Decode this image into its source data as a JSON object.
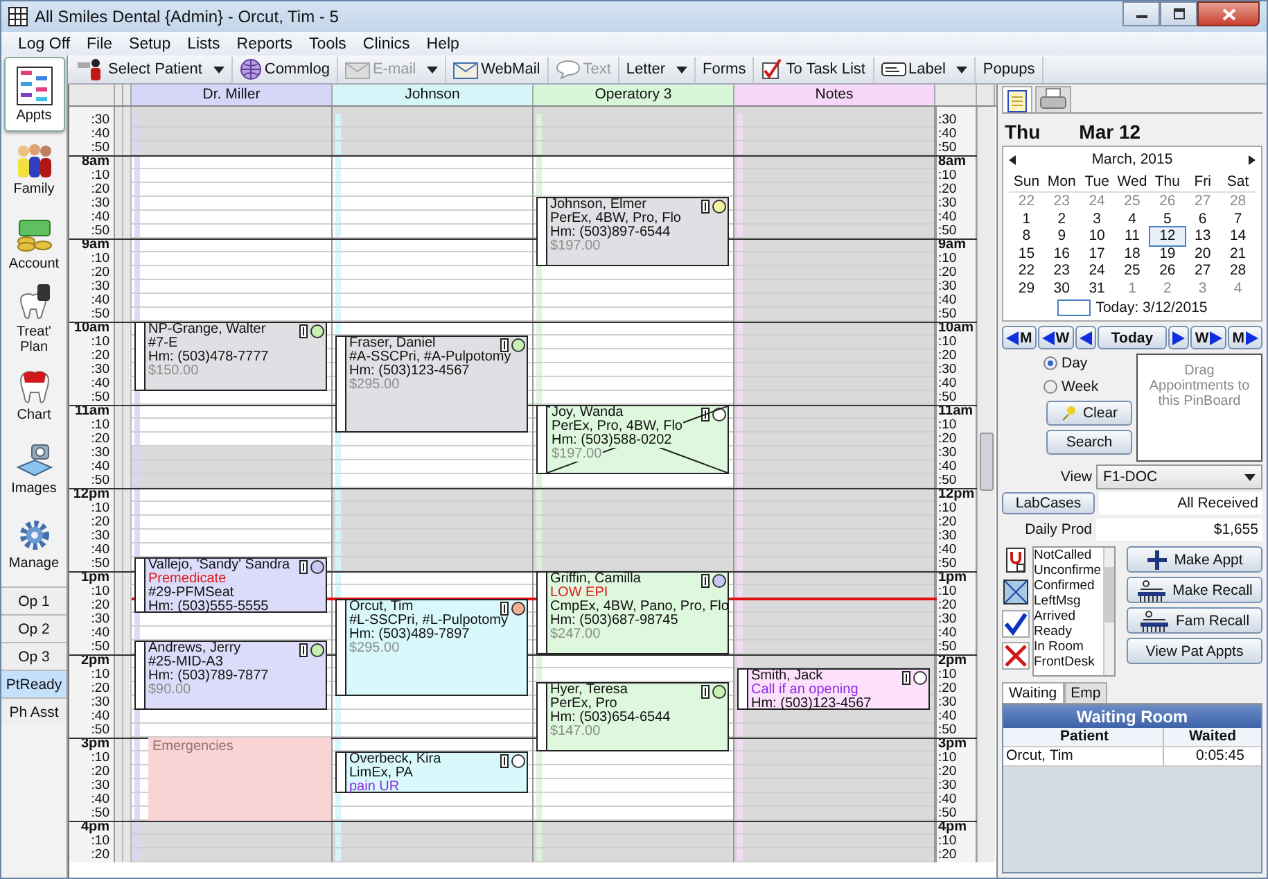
{
  "window": {
    "title": "All Smiles Dental {Admin} - Orcut, Tim - 5"
  },
  "menu": [
    "Log Off",
    "File",
    "Setup",
    "Lists",
    "Reports",
    "Tools",
    "Clinics",
    "Help"
  ],
  "toolbar": [
    {
      "label": "Select Patient",
      "disabled": false,
      "dropdown": true
    },
    {
      "label": "Commlog",
      "disabled": false,
      "dropdown": false
    },
    {
      "label": "E-mail",
      "disabled": true,
      "dropdown": true
    },
    {
      "label": "WebMail",
      "disabled": false,
      "dropdown": false
    },
    {
      "label": "Text",
      "disabled": true,
      "dropdown": false
    },
    {
      "label": "Letter",
      "disabled": false,
      "dropdown": true
    },
    {
      "label": "Forms",
      "disabled": false,
      "dropdown": false
    },
    {
      "label": "To Task List",
      "disabled": false,
      "dropdown": false
    },
    {
      "label": "Label",
      "disabled": false,
      "dropdown": true
    },
    {
      "label": "Popups",
      "disabled": false,
      "dropdown": false
    }
  ],
  "modules": [
    {
      "label": "Appts",
      "selected": true
    },
    {
      "label": "Family",
      "selected": false
    },
    {
      "label": "Account",
      "selected": false
    },
    {
      "label": "Treat' Plan",
      "selected": false
    },
    {
      "label": "Chart",
      "selected": false
    },
    {
      "label": "Images",
      "selected": false
    },
    {
      "label": "Manage",
      "selected": false
    }
  ],
  "views": [
    {
      "label": "Op 1",
      "selected": false
    },
    {
      "label": "Op 2",
      "selected": false
    },
    {
      "label": "Op 3",
      "selected": false
    },
    {
      "label": "PtReady",
      "selected": true
    },
    {
      "label": "Ph Asst",
      "selected": false
    }
  ],
  "schedule": {
    "columns": [
      {
        "name": "Dr. Miller",
        "color": "#d6d6f8",
        "blocks": [
          {
            "label": "Emergencies",
            "color": "#fad4d4"
          }
        ],
        "appointments": [
          {
            "color": "#e0e0e4",
            "broken": false,
            "dot": {
              "color": "#c8f0b0"
            },
            "lines": [
              {
                "kind": "text",
                "text": "NP-Grange, Walter"
              },
              {
                "kind": "text",
                "text": "#7-E"
              },
              {
                "kind": "text",
                "text": "Hm: (503)478-7777"
              },
              {
                "kind": "fee",
                "text": "$150.00"
              }
            ]
          },
          {
            "color": "#dcdcfa",
            "broken": false,
            "dot": {
              "color": "#c8c8f4"
            },
            "lines": [
              {
                "kind": "text",
                "text": "Vallejo, 'Sandy' Sandra"
              },
              {
                "kind": "alert",
                "text": "Premedicate"
              },
              {
                "kind": "text",
                "text": "#29-PFMSeat"
              },
              {
                "kind": "text",
                "text": "Hm: (503)555-5555"
              }
            ]
          },
          {
            "color": "#dcdcfa",
            "broken": false,
            "dot": {
              "color": "#c8f0b0"
            },
            "lines": [
              {
                "kind": "text",
                "text": "Andrews, Jerry"
              },
              {
                "kind": "text",
                "text": "#25-MID-A3"
              },
              {
                "kind": "text",
                "text": "Hm: (503)789-7877"
              },
              {
                "kind": "fee",
                "text": "$90.00"
              }
            ]
          }
        ]
      },
      {
        "name": "Johnson",
        "color": "#d4f6f8",
        "appointments": [
          {
            "color": "#e0e0e4",
            "broken": false,
            "dot": {
              "color": "#c8f0b0"
            },
            "lines": [
              {
                "kind": "text",
                "text": "Fraser, Daniel"
              },
              {
                "kind": "text",
                "text": "#A-SSCPri, #A-Pulpotomy"
              },
              {
                "kind": "text",
                "text": "Hm: (503)123-4567"
              },
              {
                "kind": "fee",
                "text": "$295.00"
              }
            ]
          },
          {
            "color": "#d8f8fc",
            "broken": false,
            "dot": {
              "color": "#f4b090"
            },
            "lines": [
              {
                "kind": "text",
                "text": "Orcut, Tim"
              },
              {
                "kind": "text",
                "text": "#L-SSCPri, #L-Pulpotomy"
              },
              {
                "kind": "text",
                "text": "Hm: (503)489-7897"
              },
              {
                "kind": "fee",
                "text": "$295.00"
              }
            ]
          },
          {
            "color": "#d8f8fc",
            "broken": false,
            "dot": {
              "color": "#ffffff"
            },
            "lines": [
              {
                "kind": "text",
                "text": "Overbeck, Kira"
              },
              {
                "kind": "text",
                "text": "LimEx, PA"
              },
              {
                "kind": "note",
                "text": "pain UR"
              }
            ]
          }
        ]
      },
      {
        "name": "Operatory 3",
        "color": "#d8f6d8",
        "appointments": [
          {
            "color": "#e0e0e4",
            "broken": false,
            "dot": {
              "color": "#f4f0a0"
            },
            "lines": [
              {
                "kind": "text",
                "text": "Johnson, Elmer"
              },
              {
                "kind": "text",
                "text": "PerEx, 4BW, Pro, Flo"
              },
              {
                "kind": "text",
                "text": "Hm: (503)897-6544"
              },
              {
                "kind": "fee",
                "text": "$197.00"
              }
            ]
          },
          {
            "color": "#ddf8dd",
            "broken": true,
            "dot": {
              "color": "#ffffff"
            },
            "lines": [
              {
                "kind": "text",
                "text": "Joy, Wanda"
              },
              {
                "kind": "text",
                "text": "PerEx, Pro, 4BW, Flo"
              },
              {
                "kind": "text",
                "text": "Hm: (503)588-0202"
              },
              {
                "kind": "fee",
                "text": "$197.00"
              }
            ]
          },
          {
            "color": "#ddf8dd",
            "broken": false,
            "dot": {
              "color": "#c8c8f4"
            },
            "lines": [
              {
                "kind": "text",
                "text": "Griffin, Camilla"
              },
              {
                "kind": "alert",
                "text": "LOW EPI"
              },
              {
                "kind": "text",
                "text": "CmpEx, 4BW, Pano, Pro, Flo"
              },
              {
                "kind": "text",
                "text": "Hm: (503)687-98745"
              },
              {
                "kind": "fee",
                "text": "$247.00"
              }
            ]
          },
          {
            "color": "#ddf8dd",
            "broken": false,
            "dot": {
              "color": "#c8f0b0"
            },
            "lines": [
              {
                "kind": "text",
                "text": "Hyer, Teresa"
              },
              {
                "kind": "text",
                "text": "PerEx, Pro"
              },
              {
                "kind": "text",
                "text": "Hm: (503)654-6544"
              },
              {
                "kind": "fee",
                "text": "$147.00"
              }
            ]
          }
        ]
      },
      {
        "name": "Notes",
        "color": "#f8d8f8",
        "appointments": [
          {
            "color": "#fce0fc",
            "broken": false,
            "dot": {
              "color": "#ffffff"
            },
            "lines": [
              {
                "kind": "text",
                "text": "Smith, Jack"
              },
              {
                "kind": "note",
                "text": "Call if an opening"
              },
              {
                "kind": "text",
                "text": "Hm: (503)123-4567"
              }
            ]
          }
        ]
      }
    ],
    "time_labels_left": [
      {
        "text": ":30",
        "kind": "minute"
      },
      {
        "text": ":40",
        "kind": "minute"
      },
      {
        "text": ":50",
        "kind": "minute"
      },
      {
        "text": "8am",
        "kind": "hour"
      },
      {
        "text": ":10",
        "kind": "minute"
      },
      {
        "text": ":20",
        "kind": "minute"
      },
      {
        "text": ":30",
        "kind": "minute"
      },
      {
        "text": ":40",
        "kind": "minute"
      },
      {
        "text": ":50",
        "kind": "minute"
      },
      {
        "text": "9am",
        "kind": "hour"
      },
      {
        "text": ":10",
        "kind": "minute"
      },
      {
        "text": ":20",
        "kind": "minute"
      },
      {
        "text": ":30",
        "kind": "minute"
      },
      {
        "text": ":40",
        "kind": "minute"
      },
      {
        "text": ":50",
        "kind": "minute"
      },
      {
        "text": "10am",
        "kind": "hour"
      },
      {
        "text": ":10",
        "kind": "minute"
      },
      {
        "text": ":20",
        "kind": "minute"
      },
      {
        "text": ":30",
        "kind": "minute"
      },
      {
        "text": ":40",
        "kind": "minute"
      },
      {
        "text": ":50",
        "kind": "minute"
      },
      {
        "text": "11am",
        "kind": "hour"
      },
      {
        "text": ":10",
        "kind": "minute"
      },
      {
        "text": ":20",
        "kind": "minute"
      },
      {
        "text": ":30",
        "kind": "minute"
      },
      {
        "text": ":40",
        "kind": "minute"
      },
      {
        "text": ":50",
        "kind": "minute"
      },
      {
        "text": "12pm",
        "kind": "hour"
      },
      {
        "text": ":10",
        "kind": "minute"
      },
      {
        "text": ":20",
        "kind": "minute"
      },
      {
        "text": ":30",
        "kind": "minute"
      },
      {
        "text": ":40",
        "kind": "minute"
      },
      {
        "text": ":50",
        "kind": "minute"
      },
      {
        "text": "1pm",
        "kind": "hour"
      },
      {
        "text": ":10",
        "kind": "minute"
      },
      {
        "text": ":20",
        "kind": "minute"
      },
      {
        "text": ":30",
        "kind": "minute"
      },
      {
        "text": ":40",
        "kind": "minute"
      },
      {
        "text": ":50",
        "kind": "minute"
      },
      {
        "text": "2pm",
        "kind": "hour"
      },
      {
        "text": ":10",
        "kind": "minute"
      },
      {
        "text": ":20",
        "kind": "minute"
      },
      {
        "text": ":30",
        "kind": "minute"
      },
      {
        "text": ":40",
        "kind": "minute"
      },
      {
        "text": ":50",
        "kind": "minute"
      },
      {
        "text": "3pm",
        "kind": "hour"
      },
      {
        "text": ":10",
        "kind": "minute"
      },
      {
        "text": ":20",
        "kind": "minute"
      },
      {
        "text": ":30",
        "kind": "minute"
      },
      {
        "text": ":40",
        "kind": "minute"
      },
      {
        "text": ":50",
        "kind": "minute"
      },
      {
        "text": "4pm",
        "kind": "hour"
      },
      {
        "text": ":10",
        "kind": "minute"
      },
      {
        "text": ":20",
        "kind": "minute"
      }
    ],
    "time_labels_right": [
      {
        "text": ":30",
        "kind": "minute"
      },
      {
        "text": ":40",
        "kind": "minute"
      },
      {
        "text": ":50",
        "kind": "minute"
      },
      {
        "text": "8am",
        "kind": "hour"
      },
      {
        "text": ":10",
        "kind": "minute"
      },
      {
        "text": ":20",
        "kind": "minute"
      },
      {
        "text": ":30",
        "kind": "minute"
      },
      {
        "text": ":40",
        "kind": "minute"
      },
      {
        "text": ":50",
        "kind": "minute"
      },
      {
        "text": "9am",
        "kind": "hour"
      },
      {
        "text": ":10",
        "kind": "minute"
      },
      {
        "text": ":20",
        "kind": "minute"
      },
      {
        "text": ":30",
        "kind": "minute"
      },
      {
        "text": ":40",
        "kind": "minute"
      },
      {
        "text": ":50",
        "kind": "minute"
      },
      {
        "text": "10am",
        "kind": "hour"
      },
      {
        "text": ":10",
        "kind": "minute"
      },
      {
        "text": ":20",
        "kind": "minute"
      },
      {
        "text": ":30",
        "kind": "minute"
      },
      {
        "text": ":40",
        "kind": "minute"
      },
      {
        "text": ":50",
        "kind": "minute"
      },
      {
        "text": "11am",
        "kind": "hour"
      },
      {
        "text": ":10",
        "kind": "minute"
      },
      {
        "text": ":20",
        "kind": "minute"
      },
      {
        "text": ":30",
        "kind": "minute"
      },
      {
        "text": ":40",
        "kind": "minute"
      },
      {
        "text": ":50",
        "kind": "minute"
      },
      {
        "text": "12pm",
        "kind": "hour"
      },
      {
        "text": ":10",
        "kind": "minute"
      },
      {
        "text": ":20",
        "kind": "minute"
      },
      {
        "text": ":30",
        "kind": "minute"
      },
      {
        "text": ":40",
        "kind": "minute"
      },
      {
        "text": ":50",
        "kind": "minute"
      },
      {
        "text": "1pm",
        "kind": "hour"
      },
      {
        "text": ":10",
        "kind": "minute"
      },
      {
        "text": ":20",
        "kind": "minute"
      },
      {
        "text": ":30",
        "kind": "minute"
      },
      {
        "text": ":40",
        "kind": "minute"
      },
      {
        "text": ":50",
        "kind": "minute"
      },
      {
        "text": "2pm",
        "kind": "hour"
      },
      {
        "text": ":10",
        "kind": "minute"
      },
      {
        "text": ":20",
        "kind": "minute"
      },
      {
        "text": ":30",
        "kind": "minute"
      },
      {
        "text": ":40",
        "kind": "minute"
      },
      {
        "text": ":50",
        "kind": "minute"
      },
      {
        "text": "3pm",
        "kind": "hour"
      },
      {
        "text": ":10",
        "kind": "minute"
      },
      {
        "text": ":20",
        "kind": "minute"
      },
      {
        "text": ":30",
        "kind": "minute"
      },
      {
        "text": ":40",
        "kind": "minute"
      },
      {
        "text": ":50",
        "kind": "minute"
      },
      {
        "text": "4pm",
        "kind": "hour"
      },
      {
        "text": ":10",
        "kind": "minute"
      },
      {
        "text": ":20",
        "kind": "minute"
      }
    ]
  },
  "day": {
    "weekday": "Thu",
    "date": "Mar 12"
  },
  "calendar": {
    "month": "March, 2015",
    "weekdays": [
      "Sun",
      "Mon",
      "Tue",
      "Wed",
      "Thu",
      "Fri",
      "Sat"
    ],
    "days": [
      {
        "label": "22",
        "other_month": true,
        "selected": false
      },
      {
        "label": "23",
        "other_month": true,
        "selected": false
      },
      {
        "label": "24",
        "other_month": true,
        "selected": false
      },
      {
        "label": "25",
        "other_month": true,
        "selected": false
      },
      {
        "label": "26",
        "other_month": true,
        "selected": false
      },
      {
        "label": "27",
        "other_month": true,
        "selected": false
      },
      {
        "label": "28",
        "other_month": true,
        "selected": false
      },
      {
        "label": "1",
        "other_month": false,
        "selected": false
      },
      {
        "label": "2",
        "other_month": false,
        "selected": false
      },
      {
        "label": "3",
        "other_month": false,
        "selected": false
      },
      {
        "label": "4",
        "other_month": false,
        "selected": false
      },
      {
        "label": "5",
        "other_month": false,
        "selected": false
      },
      {
        "label": "6",
        "other_month": false,
        "selected": false
      },
      {
        "label": "7",
        "other_month": false,
        "selected": false
      },
      {
        "label": "8",
        "other_month": false,
        "selected": false
      },
      {
        "label": "9",
        "other_month": false,
        "selected": false
      },
      {
        "label": "10",
        "other_month": false,
        "selected": false
      },
      {
        "label": "11",
        "other_month": false,
        "selected": false
      },
      {
        "label": "12",
        "other_month": false,
        "selected": true
      },
      {
        "label": "13",
        "other_month": false,
        "selected": false
      },
      {
        "label": "14",
        "other_month": false,
        "selected": false
      },
      {
        "label": "15",
        "other_month": false,
        "selected": false
      },
      {
        "label": "16",
        "other_month": false,
        "selected": false
      },
      {
        "label": "17",
        "other_month": false,
        "selected": false
      },
      {
        "label": "18",
        "other_month": false,
        "selected": false
      },
      {
        "label": "19",
        "other_month": false,
        "selected": false
      },
      {
        "label": "20",
        "other_month": false,
        "selected": false
      },
      {
        "label": "21",
        "other_month": false,
        "selected": false
      },
      {
        "label": "22",
        "other_month": false,
        "selected": false
      },
      {
        "label": "23",
        "other_month": false,
        "selected": false
      },
      {
        "label": "24",
        "other_month": false,
        "selected": false
      },
      {
        "label": "25",
        "other_month": false,
        "selected": false
      },
      {
        "label": "26",
        "other_month": false,
        "selected": false
      },
      {
        "label": "27",
        "other_month": false,
        "selected": false
      },
      {
        "label": "28",
        "other_month": false,
        "selected": false
      },
      {
        "label": "29",
        "other_month": false,
        "selected": false
      },
      {
        "label": "30",
        "other_month": false,
        "selected": false
      },
      {
        "label": "31",
        "other_month": false,
        "selected": false
      },
      {
        "label": "1",
        "other_month": true,
        "selected": false
      },
      {
        "label": "2",
        "other_month": true,
        "selected": false
      },
      {
        "label": "3",
        "other_month": true,
        "selected": false
      },
      {
        "label": "4",
        "other_month": true,
        "selected": false
      }
    ],
    "today": "Today: 3/12/2015"
  },
  "nav_buttons": [
    {
      "kind": "back",
      "label": "M"
    },
    {
      "kind": "back",
      "label": "W"
    },
    {
      "kind": "back"
    },
    {
      "kind": "plain",
      "label": "Today"
    },
    {
      "kind": "forward"
    },
    {
      "kind": "forward",
      "label": "W"
    },
    {
      "kind": "forward",
      "label": "M"
    }
  ],
  "view_mode": [
    {
      "label": "Day",
      "selected": true
    },
    {
      "label": "Week",
      "selected": false
    }
  ],
  "pin_buttons": [
    "Clear",
    "Search"
  ],
  "pinboard": {
    "hint": "Drag Appointments to this PinBoard"
  },
  "view": {
    "label": "View",
    "value": "F1-DOC"
  },
  "lab_cases": {
    "button": "LabCases",
    "value": "All Received"
  },
  "daily_prod": {
    "label": "Daily Prod",
    "value": "$1,655"
  },
  "statuses": [
    "NotCalled",
    "Unconfirme",
    "Confirmed",
    "LeftMsg",
    "Arrived",
    "Ready",
    "In Room",
    "FrontDesk"
  ],
  "actions": [
    "Make Appt",
    "Make Recall",
    "Fam Recall",
    "View Pat Appts"
  ],
  "side_tabs": [
    {
      "label": "Waiting",
      "selected": true
    },
    {
      "label": "Emp",
      "selected": false
    }
  ],
  "waiting_room": {
    "title": "Waiting Room",
    "columns": [
      "Patient",
      "Waited"
    ],
    "rows": [
      {
        "patient": "Orcut, Tim",
        "waited": "0:05:45"
      }
    ]
  }
}
